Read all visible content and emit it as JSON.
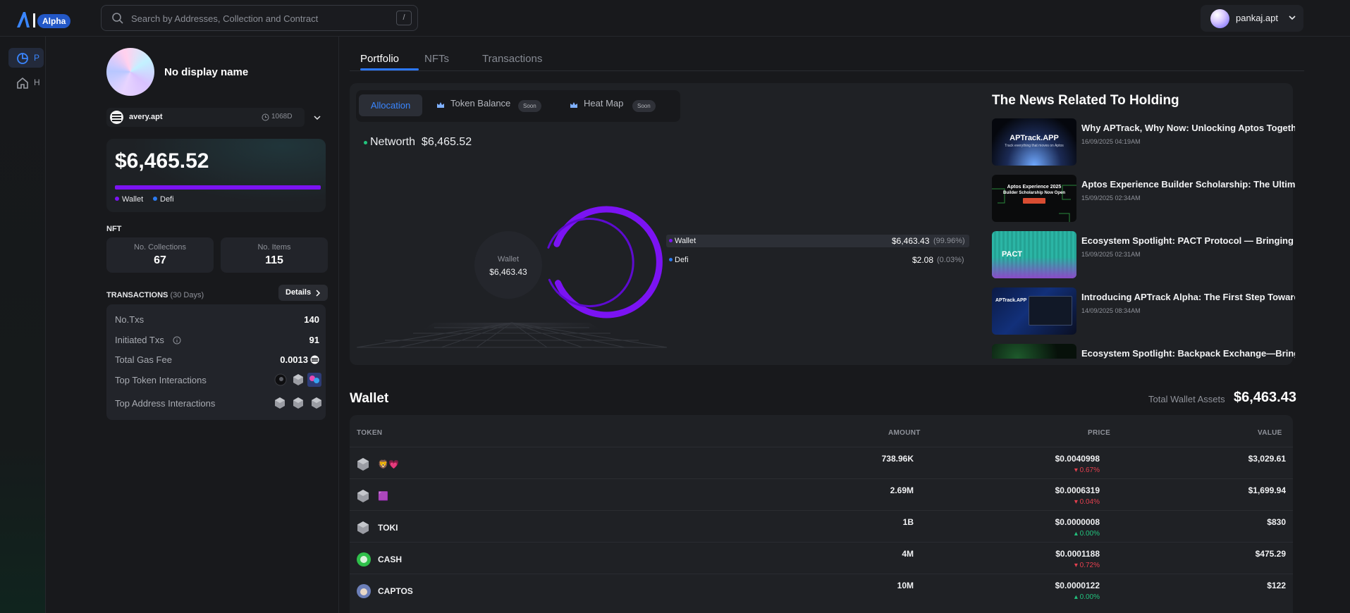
{
  "app": {
    "badge": "Alpha"
  },
  "search": {
    "placeholder": "Search by Addresses, Collection and Contract",
    "shortcut": "/"
  },
  "user": {
    "name": "pankaj.apt"
  },
  "rail": {
    "items": [
      {
        "label": "P",
        "icon": "pie-chart-icon",
        "active": true
      },
      {
        "label": "H",
        "icon": "home-icon",
        "active": false
      }
    ]
  },
  "profile": {
    "display_name": "No display name",
    "account": "avery.apt",
    "age": "1068D",
    "networth": "$6,465.52",
    "legend": [
      "Wallet",
      "Defi"
    ],
    "colors": {
      "wallet": "#7b13f3",
      "defi": "#2c7bf0"
    }
  },
  "nft": {
    "title": "NFT",
    "collections_label": "No. Collections",
    "collections": "67",
    "items_label": "No. Items",
    "items": "115"
  },
  "transactions": {
    "title": "TRANSACTIONS",
    "period": "(30 Days)",
    "details_label": "Details",
    "rows": [
      {
        "label": "No.Txs",
        "value": "140"
      },
      {
        "label": "Initiated Txs",
        "value": "91"
      },
      {
        "label": "Total Gas Fee",
        "value": "0.0013"
      },
      {
        "label": "Top Token Interactions",
        "value": ""
      },
      {
        "label": "Top Address Interactions",
        "value": ""
      }
    ]
  },
  "tabs": [
    "Portfolio",
    "NFTs",
    "Transactions"
  ],
  "subtabs": [
    {
      "label": "Allocation",
      "badge": ""
    },
    {
      "label": "Token Balance",
      "badge": "Soon"
    },
    {
      "label": "Heat Map",
      "badge": "Soon"
    }
  ],
  "networth": {
    "label": "Networth",
    "value": "$6,465.52"
  },
  "donut": {
    "center_label": "Wallet",
    "center_value": "$6,463.43",
    "wallet_fraction": 0.9996
  },
  "allocation": [
    {
      "name": "Wallet",
      "value": "$6,463.43",
      "pct": "(99.96%)"
    },
    {
      "name": "Defi",
      "value": "$2.08",
      "pct": "(0.03%)"
    }
  ],
  "news": {
    "title": "The News Related To Holding",
    "items": [
      {
        "headline": "Why APTrack, Why Now: Unlocking Aptos Together",
        "date": "16/09/2025 04:19AM",
        "thumb_text": "APTrack.APP",
        "thumb_sub": "Track everything that moves on Aptos"
      },
      {
        "headline": "Aptos Experience Builder Scholarship: The Ultimate",
        "date": "15/09/2025 02:34AM",
        "thumb_text": "Aptos Experience 2025",
        "thumb_sub": "Builder Scholarship Now Open"
      },
      {
        "headline": "Ecosystem Spotlight: PACT Protocol — Bringing Over",
        "date": "15/09/2025 02:31AM",
        "thumb_text": "PACT",
        "thumb_sub": ""
      },
      {
        "headline": "Introducing APTrack Alpha: The First Step Towards",
        "date": "14/09/2025 08:34AM",
        "thumb_text": "APTrack.APP",
        "thumb_sub": ""
      },
      {
        "headline": "Ecosystem Spotlight: Backpack Exchange—Bringing",
        "date": "",
        "thumb_text": "",
        "thumb_sub": ""
      }
    ]
  },
  "wallet": {
    "title": "Wallet",
    "total_label": "Total Wallet Assets",
    "total_value": "$6,463.43",
    "columns": [
      "TOKEN",
      "AMOUNT",
      "PRICE",
      "VALUE"
    ],
    "rows": [
      {
        "token": "🦁💗",
        "amount": "738.96K",
        "price": "$0.0040998",
        "change": "0.67%",
        "dir": "down",
        "value": "$3,029.61",
        "icon": "hex-icon"
      },
      {
        "token": "🟪",
        "amount": "2.69M",
        "price": "$0.0006319",
        "change": "0.04%",
        "dir": "down",
        "value": "$1,699.94",
        "icon": "hex-icon"
      },
      {
        "token": "TOKI",
        "amount": "1B",
        "price": "$0.0000008",
        "change": "0.00%",
        "dir": "up",
        "value": "$830",
        "icon": "hex-icon"
      },
      {
        "token": "CASH",
        "amount": "4M",
        "price": "$0.0001188",
        "change": "0.72%",
        "dir": "down",
        "value": "$475.29",
        "icon": "cash-token-icon"
      },
      {
        "token": "CAPTOS",
        "amount": "10M",
        "price": "$0.0000122",
        "change": "0.00%",
        "dir": "up",
        "value": "$122",
        "icon": "captos-token-icon"
      }
    ]
  }
}
